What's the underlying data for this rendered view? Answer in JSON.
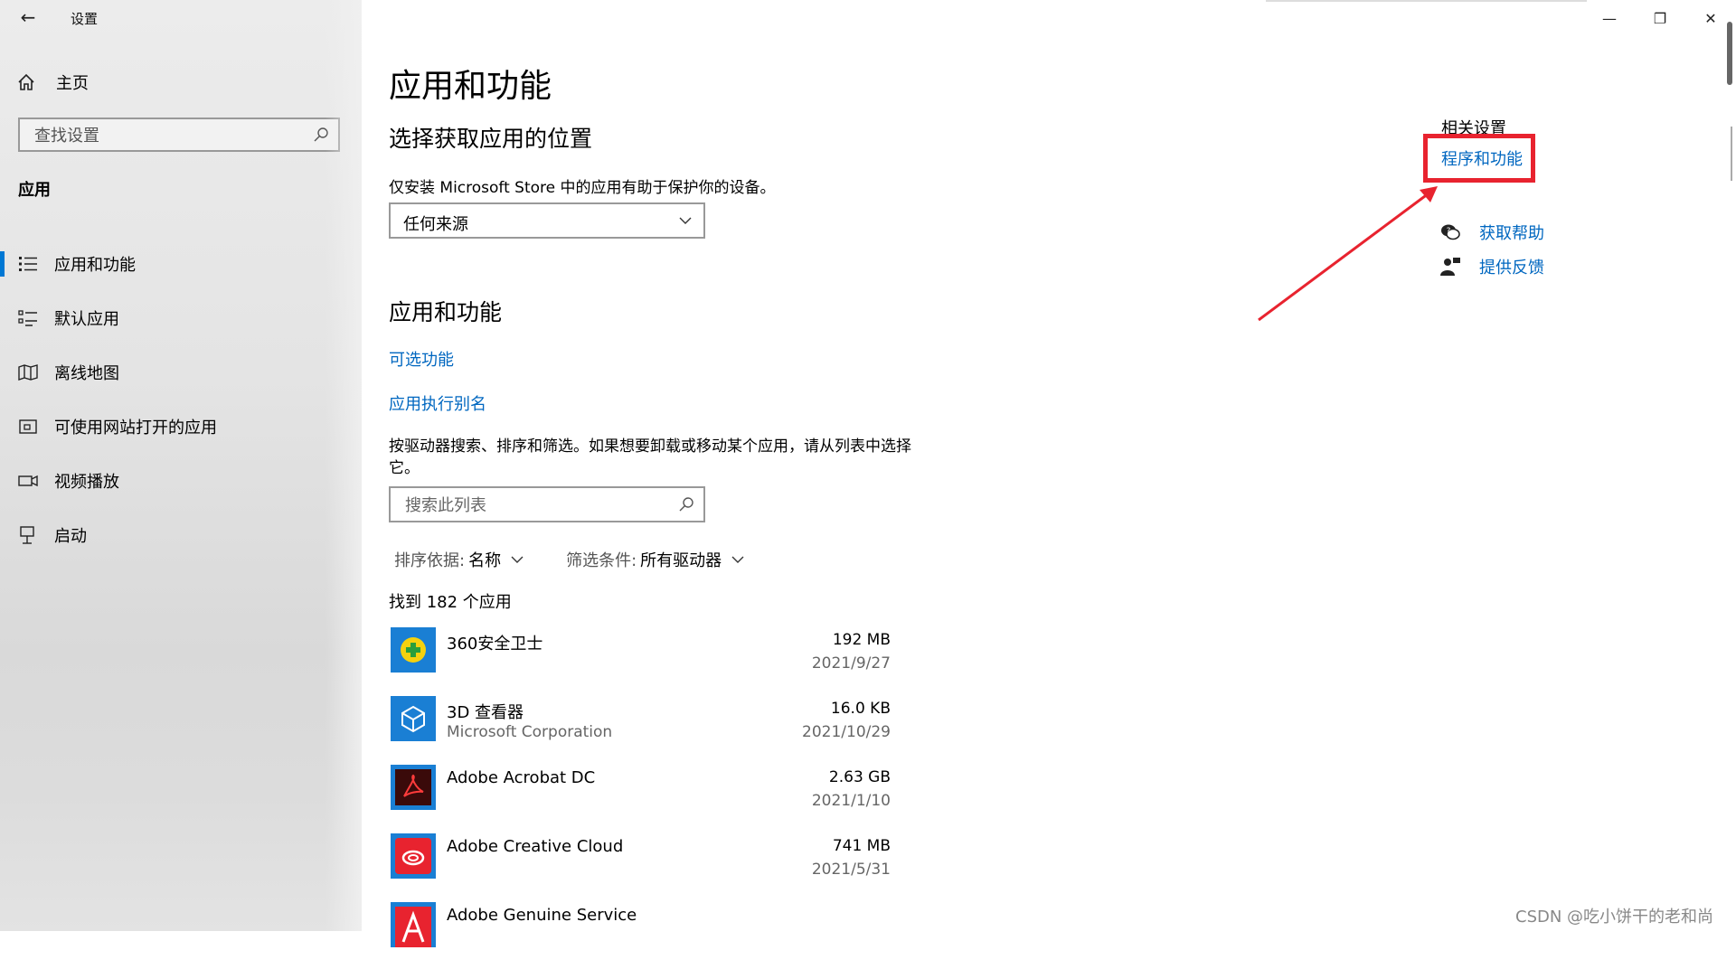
{
  "window": {
    "title": "设置",
    "controls": {
      "minimize": "—",
      "maximize": "❐",
      "close": "✕"
    }
  },
  "sidebar": {
    "home_label": "主页",
    "search_placeholder": "查找设置",
    "section": "应用",
    "items": [
      {
        "label": "应用和功能",
        "icon": "apps-features-icon",
        "active": true
      },
      {
        "label": "默认应用",
        "icon": "default-apps-icon",
        "active": false
      },
      {
        "label": "离线地图",
        "icon": "offline-maps-icon",
        "active": false
      },
      {
        "label": "可使用网站打开的应用",
        "icon": "apps-for-websites-icon",
        "active": false
      },
      {
        "label": "视频播放",
        "icon": "video-playback-icon",
        "active": false
      },
      {
        "label": "启动",
        "icon": "startup-icon",
        "active": false
      }
    ]
  },
  "main": {
    "page_title": "应用和功能",
    "choose_title": "选择获取应用的位置",
    "store_note": "仅安装 Microsoft Store 中的应用有助于保护你的设备。",
    "source_dropdown": "任何来源",
    "apps_title": "应用和功能",
    "link_optional": "可选功能",
    "link_alias": "应用执行别名",
    "instructions": "按驱动器搜索、排序和筛选。如果想要卸载或移动某个应用，请从列表中选择它。",
    "list_search_placeholder": "搜索此列表",
    "sort_key": "排序依据:",
    "sort_value": "名称",
    "filter_key": "筛选条件:",
    "filter_value": "所有驱动器",
    "found": "找到 182 个应用",
    "apps": [
      {
        "name": "360安全卫士",
        "publisher": "",
        "size": "192 MB",
        "date": "2021/9/27",
        "icon": "360-security-icon"
      },
      {
        "name": "3D 查看器",
        "publisher": "Microsoft Corporation",
        "size": "16.0 KB",
        "date": "2021/10/29",
        "icon": "3d-viewer-icon"
      },
      {
        "name": "Adobe Acrobat DC",
        "publisher": "",
        "size": "2.63 GB",
        "date": "2021/1/10",
        "icon": "acrobat-icon"
      },
      {
        "name": "Adobe Creative Cloud",
        "publisher": "",
        "size": "741 MB",
        "date": "2021/5/31",
        "icon": "creative-cloud-icon"
      },
      {
        "name": "Adobe Genuine Service",
        "publisher": "",
        "size": "",
        "date": "",
        "icon": "adobe-genuine-icon"
      }
    ]
  },
  "related": {
    "title": "相关设置",
    "programs_link": "程序和功能",
    "help": "获取帮助",
    "feedback": "提供反馈"
  },
  "watermark": "CSDN @吃小饼干的老和尚",
  "colors": {
    "accent": "#0078d4",
    "link": "#0067c0",
    "highlight": "#e8232f"
  }
}
